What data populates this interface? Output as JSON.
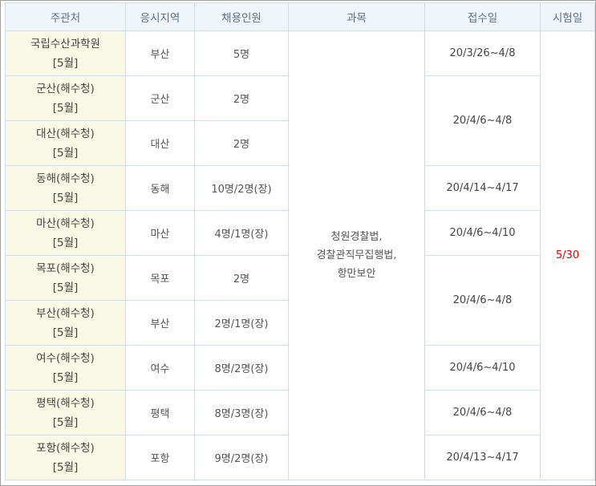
{
  "headers": [
    "주관처",
    "응시지역",
    "채용인원",
    "과목",
    "접수일",
    "시험일"
  ],
  "rows": [
    {
      "org": "국립수산과학원",
      "month": "[5월]",
      "region": "부산",
      "count": "5명"
    },
    {
      "org": "군산(해수청)",
      "month": "[5월]",
      "region": "군산",
      "count": "2명"
    },
    {
      "org": "대산(해수청)",
      "month": "[5월]",
      "region": "대산",
      "count": "2명"
    },
    {
      "org": "동해(해수청)",
      "month": "[5월]",
      "region": "동해",
      "count": "10명/2명(장)"
    },
    {
      "org": "마산(해수청)",
      "month": "[5월]",
      "region": "마산",
      "count": "4명/1명(장)"
    },
    {
      "org": "목포(해수청)",
      "month": "[5월]",
      "region": "목포",
      "count": "2명"
    },
    {
      "org": "부산(해수청)",
      "month": "[5월]",
      "region": "부산",
      "count": "2명/1명(장)"
    },
    {
      "org": "여수(해수청)",
      "month": "[5월]",
      "region": "여수",
      "count": "8명/2명(장)"
    },
    {
      "org": "평택(해수청)",
      "month": "[5월]",
      "region": "평택",
      "count": "8명/3명(장)"
    },
    {
      "org": "포항(해수청)",
      "month": "[5월]",
      "region": "포항",
      "count": "9명/2명(장)"
    }
  ],
  "subjects": [
    "청원경찰법,",
    "경찰관직무집행법,",
    "항만보안"
  ],
  "dates": [
    "20/3/26~4/8",
    "20/4/6~4/8",
    "20/4/14~4/17",
    "20/4/6~4/10",
    "20/4/6~4/8",
    "20/4/6~4/10",
    "20/4/6~4/8",
    "20/4/13~4/17"
  ],
  "exam_date": "5/30"
}
